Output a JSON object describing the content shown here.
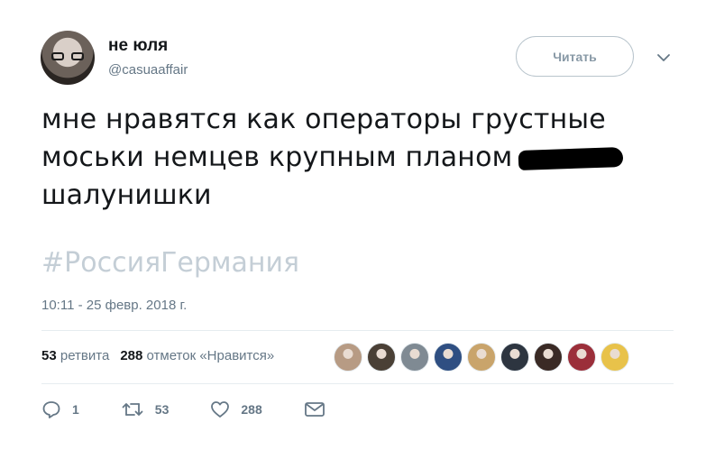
{
  "author": {
    "name": "не юля",
    "handle": "@casuaaffair"
  },
  "follow_button": {
    "label": "Читать"
  },
  "menu": {
    "icon": "chevron-down-icon"
  },
  "tweet": {
    "lines": [
      "мне нравятся как операторы грустные",
      "моськи немцев крупным планом",
      "шалунишки"
    ],
    "hashtag": "#РоссияГермания",
    "timestamp": "10:11 - 25 февр. 2018 г."
  },
  "stats": {
    "retweets_count": "53",
    "retweets_label": "ретвита",
    "likes_count": "288",
    "likes_label": "отметок «Нравится»"
  },
  "liker_avatars": [
    {
      "color": "#b79b84"
    },
    {
      "color": "#4a4036"
    },
    {
      "color": "#7f8a93"
    },
    {
      "color": "#2f4f82"
    },
    {
      "color": "#c9a46b"
    },
    {
      "color": "#2d3540"
    },
    {
      "color": "#3a2a25"
    },
    {
      "color": "#9b2f3a"
    },
    {
      "color": "#e8c24a"
    }
  ],
  "actions": {
    "reply": {
      "icon": "reply-icon",
      "count": "1"
    },
    "retweet": {
      "icon": "retweet-icon",
      "count": "53"
    },
    "like": {
      "icon": "heart-icon",
      "count": "288"
    },
    "message": {
      "icon": "envelope-icon"
    }
  },
  "colors": {
    "text": "#14171a",
    "muted": "#657786",
    "hashtag": "#c4ced6",
    "divider": "#e6ecf0"
  }
}
